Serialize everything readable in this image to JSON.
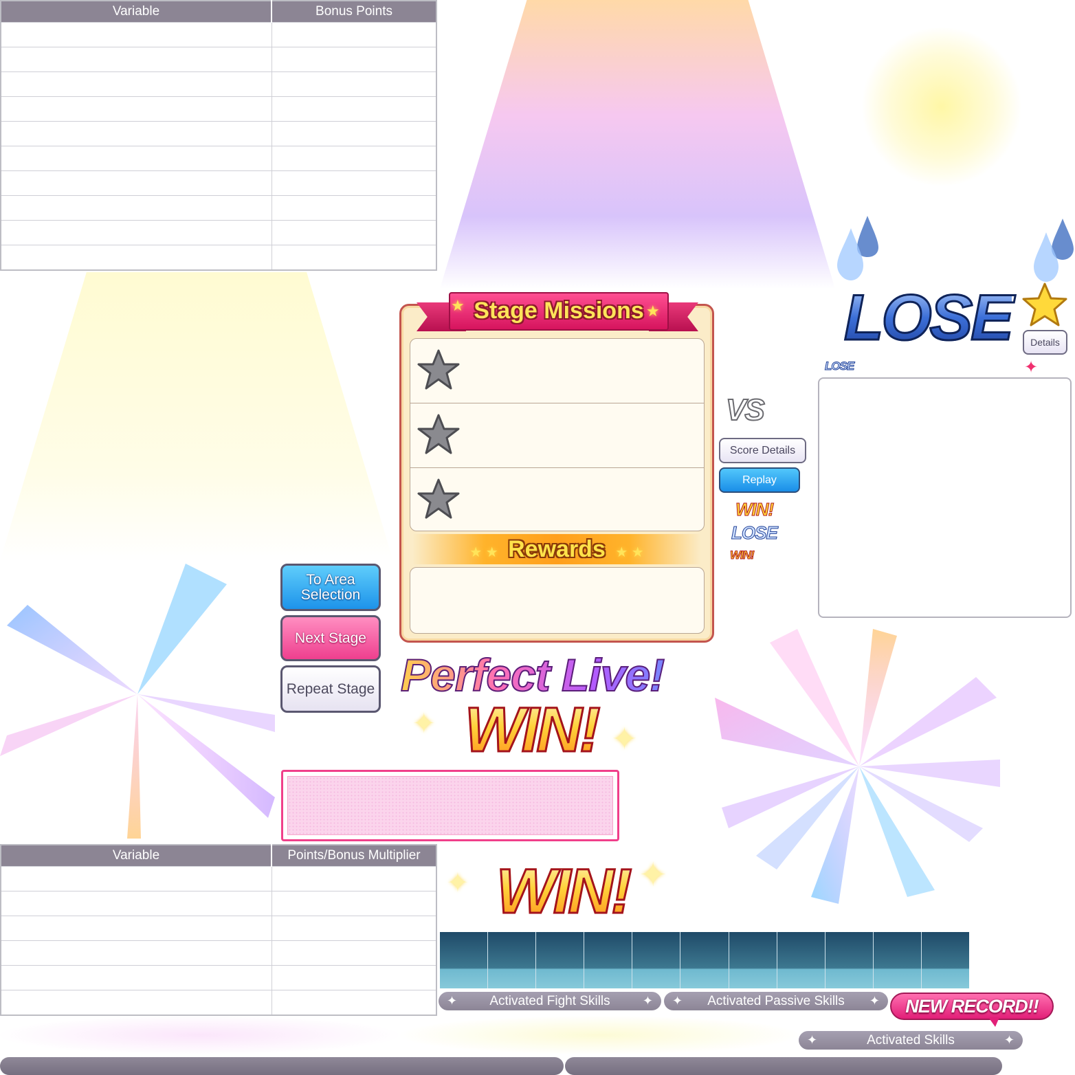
{
  "bonus_table": {
    "headers": [
      "Variable",
      "Bonus Points"
    ],
    "row_count": 10
  },
  "multiplier_table": {
    "headers": [
      "Variable",
      "Points/Bonus Multiplier"
    ],
    "row_count": 6
  },
  "stage_missions": {
    "title": "Stage Missions",
    "rewards_label": "Rewards",
    "mission_count": 3,
    "star_icon": "grey-star-icon"
  },
  "buttons": {
    "to_area_selection": "To Area Selection",
    "next_stage": "Next Stage",
    "repeat_stage": "Repeat Stage",
    "score_details": "Score Details",
    "replay": "Replay",
    "details": "Details"
  },
  "logos": {
    "perfect_live": "Perfect Live!",
    "win": "WIN!",
    "lose": "LOSE",
    "vs": "VS",
    "new_record": "NEW RECORD!!"
  },
  "skill_bars": {
    "fight": "Activated Fight Skills",
    "passive": "Activated Passive Skills",
    "skills": "Activated Skills"
  },
  "colors": {
    "accent_pink": "#f03f8a",
    "accent_blue": "#1d93ea",
    "header_grey": "#8c8594",
    "panel_border": "#c3554e"
  }
}
